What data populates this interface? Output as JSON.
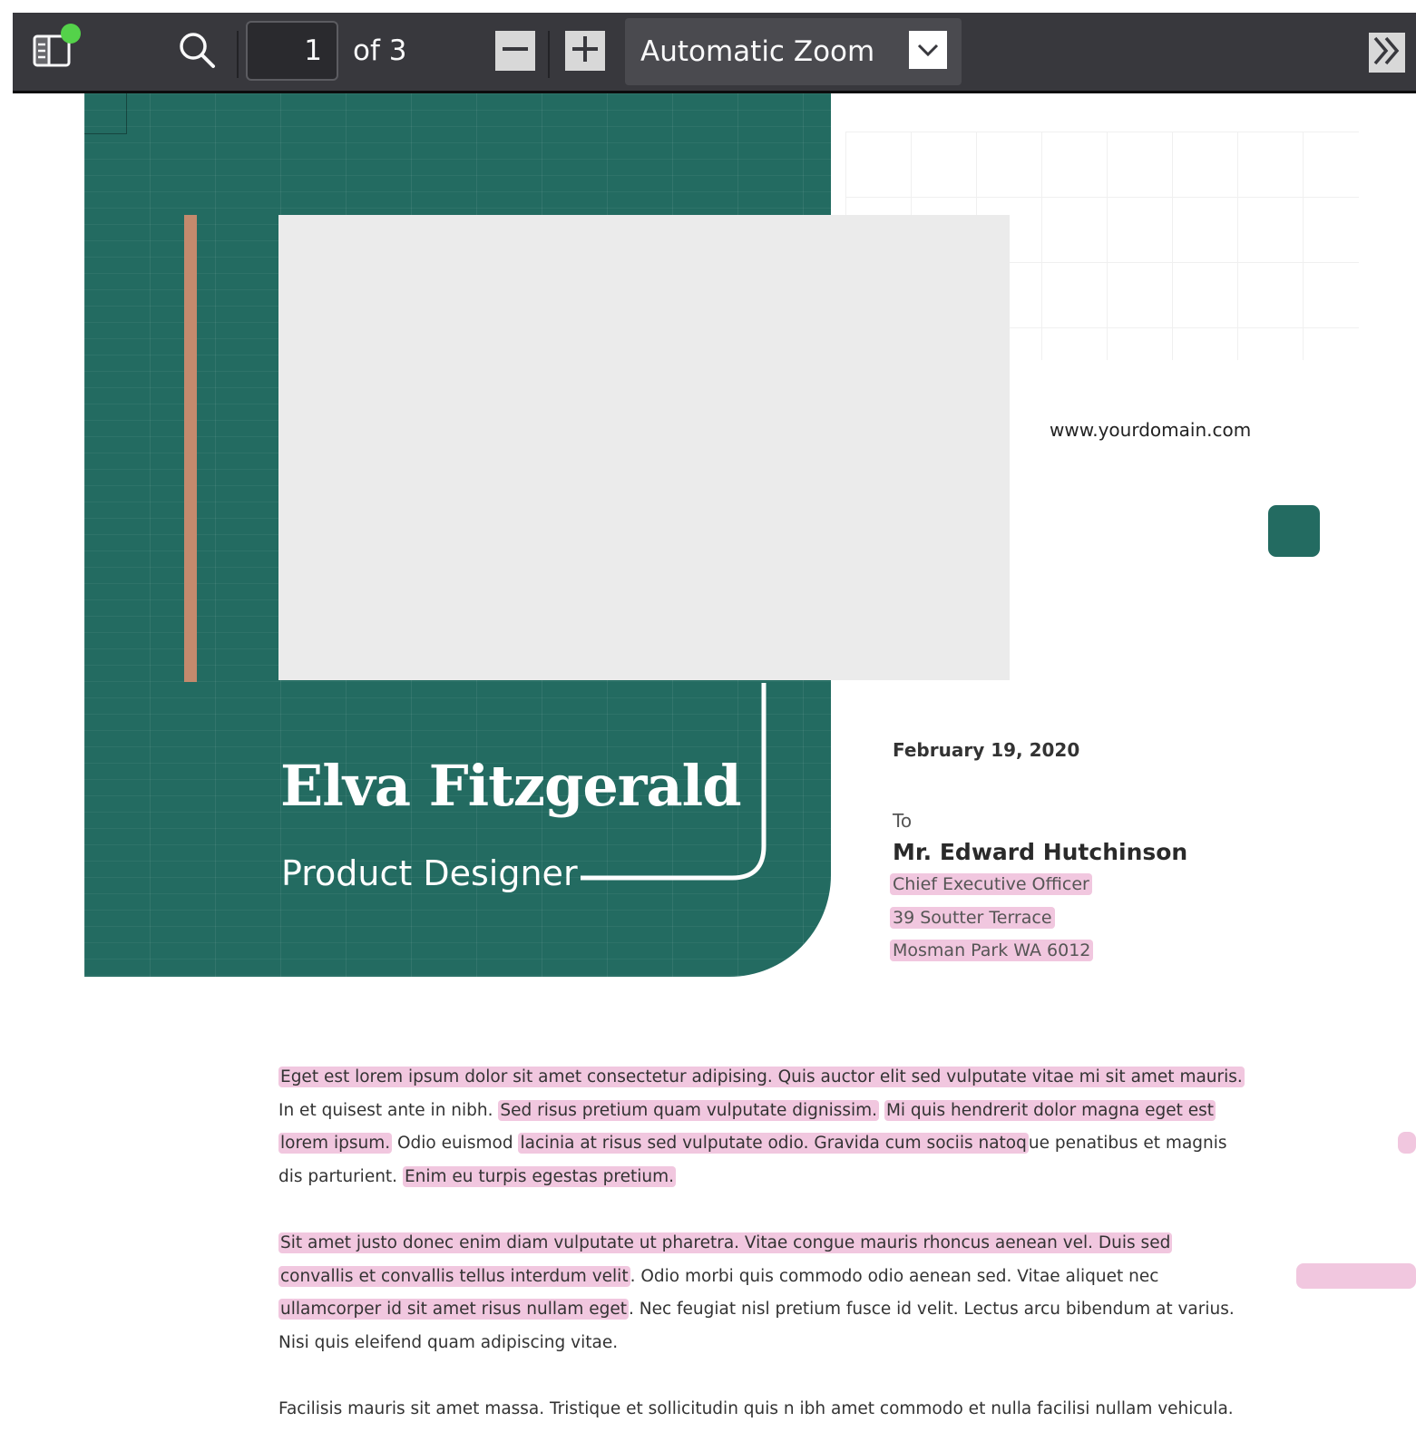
{
  "toolbar": {
    "page_current": "1",
    "page_count_text": "of 3",
    "zoom_label": "Automatic Zoom",
    "icons": [
      "sidebar-toggle-icon",
      "search-icon",
      "zoom-out-icon",
      "zoom-in-icon",
      "chevron-down-icon",
      "double-chevron-right-icon"
    ],
    "colors": {
      "background": "#38383d",
      "text": "#f9f9fa",
      "notification": "#54d24a"
    }
  },
  "document": {
    "name": "Elva Fitzgerald",
    "title": "Product Designer",
    "website": "www.yourdomain.com",
    "date": "February 19, 2020",
    "to_label": "To",
    "recipient": {
      "name": "Mr. Edward Hutchinson",
      "position": "Chief Executive Officer",
      "street": "39 Soutter Terrace",
      "city": "Mosman Park WA 6012"
    },
    "paragraph1": {
      "l1": "Eget est lorem ipsum dolor sit amet consectetur adipising. Quis auctor elit sed vulputate vitae mi sit amet mauris.",
      "l2a": "In et quisest ante in nibh. ",
      "l2b": "Sed risus pretium quam vulputate dignissim.",
      "l2c": " ",
      "l2d": "Mi quis hendrerit dolor magna eget est",
      "l3a": "lorem ipsum.",
      "l3b": " Odio euismod ",
      "l3c": "lacinia at risus sed vulputate odio. Gravida cum sociis natoq",
      "l3d": "ue penatibus et magnis",
      "l4a": "dis parturient. ",
      "l4b": "Enim eu turpis egestas pretium."
    },
    "paragraph2": {
      "l1": "Sit amet justo donec enim diam vulputate ut pharetra. Vitae congue mauris rhoncus aenean vel. Duis sed",
      "l2a": "convallis et convallis tellus interdum velit",
      "l2b": ". Odio morbi quis commodo odio aenean sed. Vitae aliquet nec",
      "l3a": "ullamcorper id  sit amet risus nullam eget",
      "l3b": ". Nec feugiat nisl pretium fusce id velit. Lectus arcu bibendum at varius.",
      "l4": "Nisi quis eleifend quam adipiscing vitae."
    },
    "paragraph3": {
      "l1": "Facilisis mauris sit amet massa. Tristique et sollicitudin quis n ibh amet commodo et nulla facilisi nullam vehicula."
    },
    "colors": {
      "panel_green": "#236b61",
      "accent_bar": "#c48a6d",
      "highlight": "#f1c7df"
    }
  }
}
